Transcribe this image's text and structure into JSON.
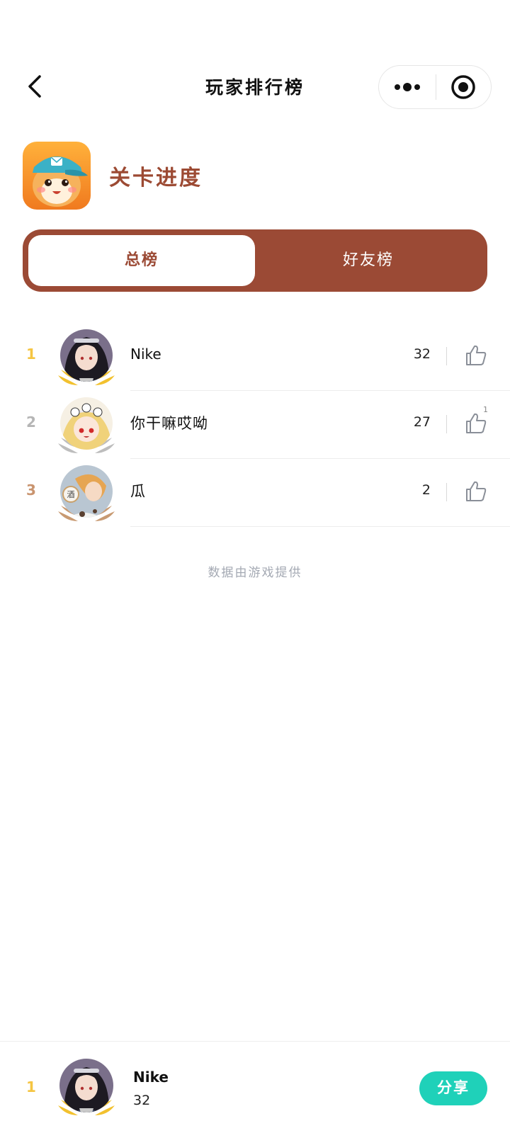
{
  "nav": {
    "title": "玩家排行榜"
  },
  "game": {
    "name": "关卡进度"
  },
  "tabs": [
    {
      "label": "总榜",
      "active": true
    },
    {
      "label": "好友榜",
      "active": false
    }
  ],
  "ranking": [
    {
      "rank": "1",
      "name": "Nike",
      "score": "32",
      "likes": "",
      "rank_color": "#f5c542",
      "laurel_color": "#f2c12e"
    },
    {
      "rank": "2",
      "name": "你干嘛哎呦",
      "score": "27",
      "likes": "1",
      "rank_color": "#b5b5b5",
      "laurel_color": "#bdbdbd"
    },
    {
      "rank": "3",
      "name": "瓜",
      "score": "2",
      "likes": "",
      "rank_color": "#c9946f",
      "laurel_color": "#c89a72"
    }
  ],
  "footnote": "数据由游戏提供",
  "me": {
    "rank": "1",
    "name": "Nike",
    "score": "32",
    "rank_color": "#f5c542"
  },
  "share_label": "分享",
  "colors": {
    "brand": "#9b4a35",
    "share": "#1fd1b9",
    "gold": "#f2c12e",
    "silver": "#bdbdbd",
    "bronze": "#c89a72"
  }
}
